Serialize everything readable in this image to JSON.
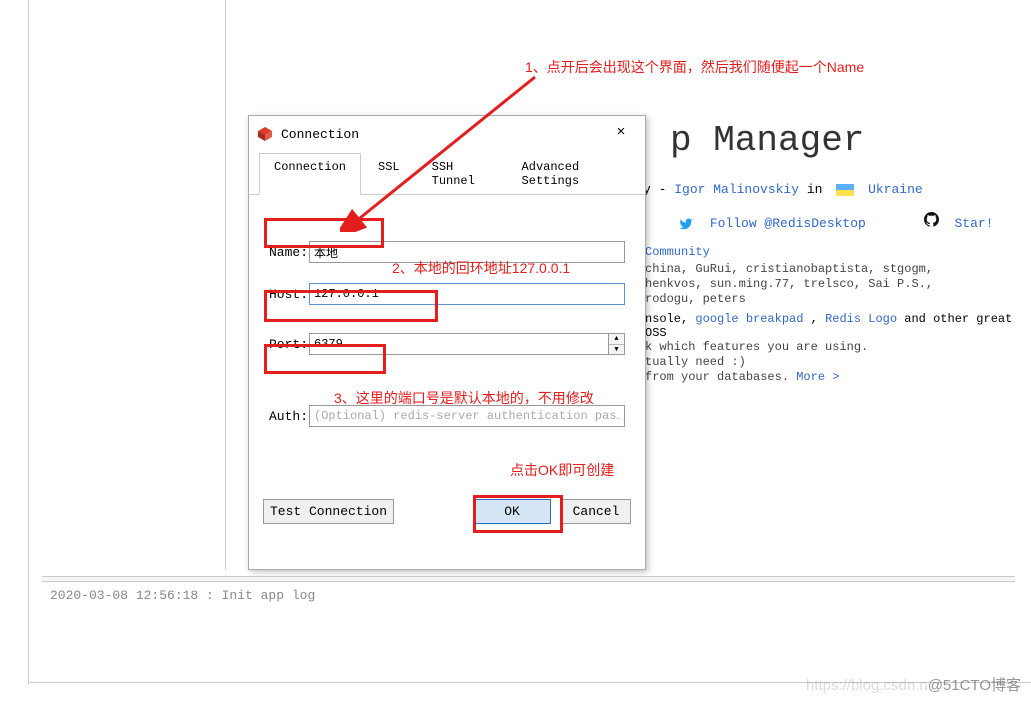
{
  "annotations": {
    "a1": "1、点开后会出现这个界面，然后我们随便起一个Name",
    "a2": "2、本地的回环地址127.0.0.1",
    "a3": "3、这里的端口号是默认本地的，不用修改",
    "a4": "点击OK即可创建"
  },
  "dialog": {
    "title": "Connection",
    "close": "×",
    "tabs": {
      "connection": "Connection",
      "ssl": "SSL",
      "ssh": "SSH Tunnel",
      "advanced": "Advanced Settings"
    },
    "fields": {
      "name_label": "Name:",
      "name_value": "本地",
      "host_label": "Host:",
      "host_value": "127.0.0.1",
      "port_label": "Port:",
      "port_value": "6379",
      "auth_label": "Auth:",
      "auth_placeholder": "(Optional) redis-server authentication pas…"
    },
    "buttons": {
      "test": "Test Connection",
      "ok": "OK",
      "cancel": "Cancel"
    }
  },
  "background": {
    "title_suffix": "p Manager",
    "by_prefix": "y - ",
    "author": "Igor Malinovskiy",
    "in_text": " in ",
    "ukraine": "Ukraine",
    "follow": "Follow @RedisDesktop",
    "star": "Star!",
    "community_label": "Community",
    "supporters": "china, GuRui, cristianobaptista, stgogm,\n henkvos, sun.ming.77, trelsco, Sai P.S.,\nrodogu, peters",
    "oss": {
      "pre": "nsole, ",
      "l1": "google breakpad",
      "mid": ", ",
      "l2": "Redis Logo",
      "post": " and other great OSS"
    },
    "features": {
      "l1": "k which features you are using.",
      "l2": "tually need :)",
      "l3_pre": " from your databases. ",
      "l3_link": "More >"
    }
  },
  "log": {
    "text": "2020-03-08 12:56:18 : Init app log"
  },
  "watermark": {
    "csdn": "https://blog.csdn.n",
    "cto": "@51CTO博客"
  }
}
